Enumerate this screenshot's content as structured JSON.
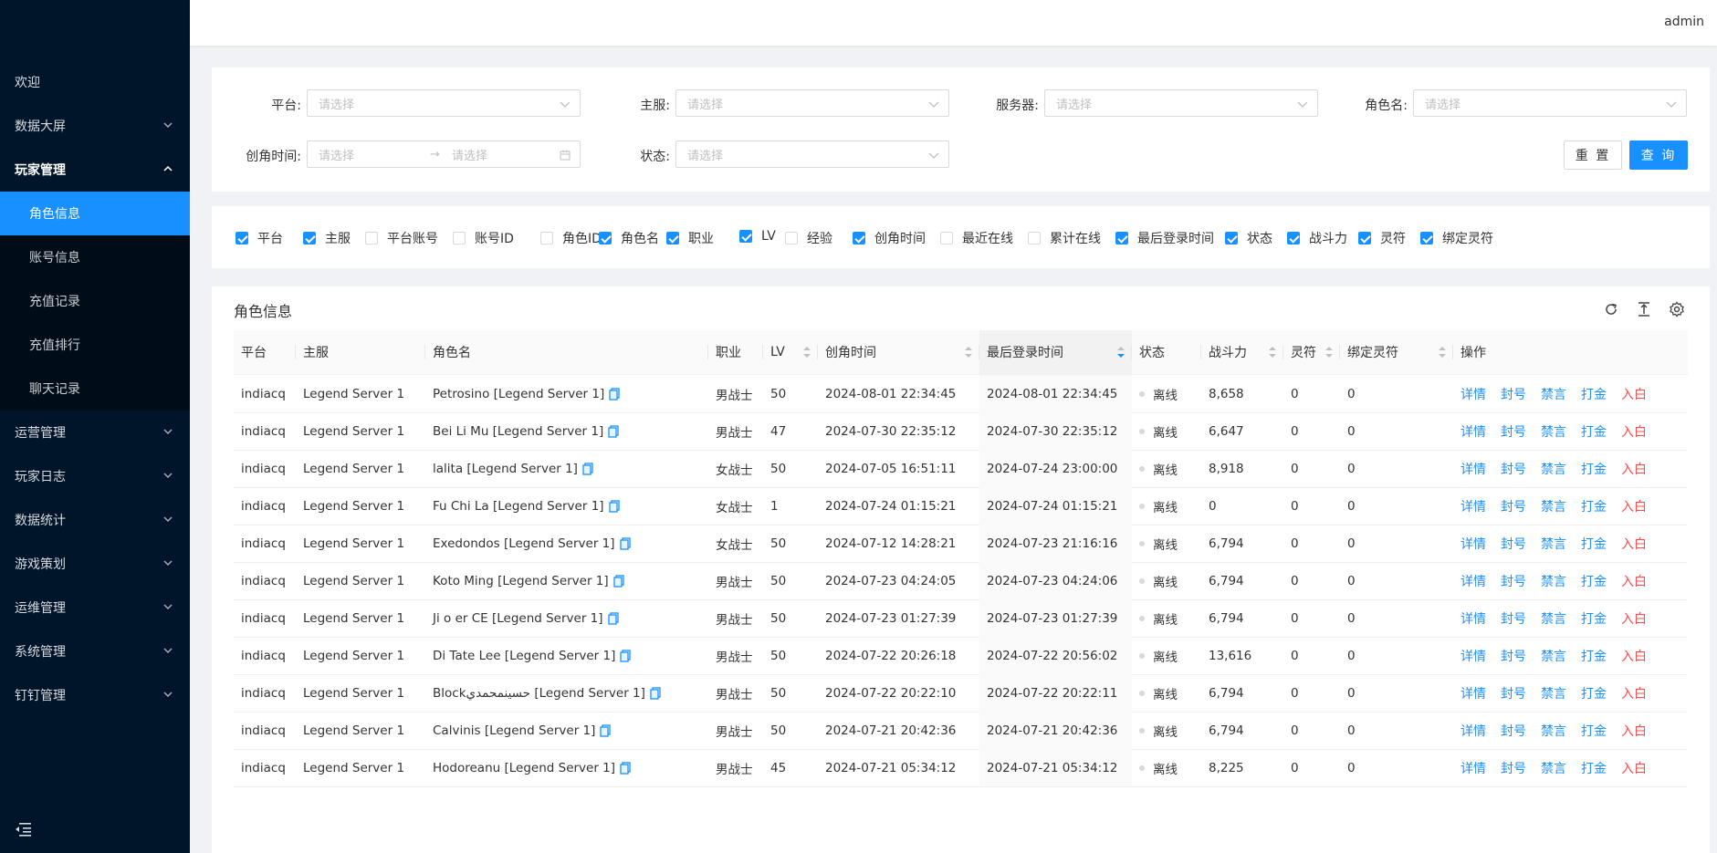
{
  "header": {
    "user": "admin"
  },
  "sidebar": {
    "items": [
      {
        "label": "欢迎",
        "type": "top",
        "chev": false
      },
      {
        "label": "数据大屏",
        "type": "top",
        "chev": "down"
      },
      {
        "label": "玩家管理",
        "type": "open",
        "chev": "up"
      },
      {
        "label": "角色信息",
        "type": "active"
      },
      {
        "label": "账号信息",
        "type": "sub"
      },
      {
        "label": "充值记录",
        "type": "sub"
      },
      {
        "label": "充值排行",
        "type": "sub"
      },
      {
        "label": "聊天记录",
        "type": "sub"
      },
      {
        "label": "运营管理",
        "type": "top",
        "chev": "down"
      },
      {
        "label": "玩家日志",
        "type": "top",
        "chev": "down"
      },
      {
        "label": "数据统计",
        "type": "top",
        "chev": "down"
      },
      {
        "label": "游戏策划",
        "type": "top",
        "chev": "down"
      },
      {
        "label": "运维管理",
        "type": "top",
        "chev": "down"
      },
      {
        "label": "系统管理",
        "type": "top",
        "chev": "down"
      },
      {
        "label": "钉钉管理",
        "type": "top",
        "chev": "down"
      }
    ]
  },
  "filters": {
    "platform": {
      "label": "平台:",
      "placeholder": "请选择"
    },
    "main_server": {
      "label": "主服:",
      "placeholder": "请选择"
    },
    "server": {
      "label": "服务器:",
      "placeholder": "请选择"
    },
    "role_name": {
      "label": "角色名:",
      "placeholder": "请选择"
    },
    "created": {
      "label": "创角时间:",
      "start": "请选择",
      "end": "请选择"
    },
    "status": {
      "label": "状态:",
      "placeholder": "请选择"
    },
    "reset": "重 置",
    "query": "查 询"
  },
  "columns": [
    {
      "label": "平台",
      "checked": true
    },
    {
      "label": "主服",
      "checked": true
    },
    {
      "label": "平台账号",
      "checked": false
    },
    {
      "label": "账号ID",
      "checked": false
    },
    {
      "label": "角色ID",
      "checked": false
    },
    {
      "label": "角色名",
      "checked": true
    },
    {
      "label": "职业",
      "checked": true
    },
    {
      "label": "LV",
      "checked": true
    },
    {
      "label": "经验",
      "checked": false
    },
    {
      "label": "创角时间",
      "checked": true
    },
    {
      "label": "最近在线",
      "checked": false
    },
    {
      "label": "累计在线",
      "checked": false
    },
    {
      "label": "最后登录时间",
      "checked": true
    },
    {
      "label": "状态",
      "checked": true
    },
    {
      "label": "战斗力",
      "checked": true
    },
    {
      "label": "灵符",
      "checked": true
    },
    {
      "label": "绑定灵符",
      "checked": true
    }
  ],
  "table": {
    "title": "角色信息",
    "headers": [
      "平台",
      "主服",
      "角色名",
      "职业",
      "LV",
      "创角时间",
      "最后登录时间",
      "状态",
      "战斗力",
      "灵符",
      "绑定灵符",
      "操作"
    ],
    "actions": [
      "详情",
      "封号",
      "禁言",
      "打金",
      "入白"
    ],
    "rows": [
      {
        "platform": "indiacq",
        "server": "Legend Server 1",
        "name": "Petrosino [Legend Server 1]",
        "class": "男战士",
        "lv": "50",
        "created": "2024-08-01 22:34:45",
        "last": "2024-08-01 22:34:45",
        "status": "离线",
        "power": "8,658",
        "fu": "0",
        "bfu": "0"
      },
      {
        "platform": "indiacq",
        "server": "Legend Server 1",
        "name": "Bei Li Mu [Legend Server 1]",
        "class": "男战士",
        "lv": "47",
        "created": "2024-07-30 22:35:12",
        "last": "2024-07-30 22:35:12",
        "status": "离线",
        "power": "6,647",
        "fu": "0",
        "bfu": "0"
      },
      {
        "platform": "indiacq",
        "server": "Legend Server 1",
        "name": "lalita [Legend Server 1]",
        "class": "女战士",
        "lv": "50",
        "created": "2024-07-05 16:51:11",
        "last": "2024-07-24 23:00:00",
        "status": "离线",
        "power": "8,918",
        "fu": "0",
        "bfu": "0"
      },
      {
        "platform": "indiacq",
        "server": "Legend Server 1",
        "name": "Fu Chi La [Legend Server 1]",
        "class": "女战士",
        "lv": "1",
        "created": "2024-07-24 01:15:21",
        "last": "2024-07-24 01:15:21",
        "status": "离线",
        "power": "0",
        "fu": "0",
        "bfu": "0"
      },
      {
        "platform": "indiacq",
        "server": "Legend Server 1",
        "name": "Exedondos [Legend Server 1]",
        "class": "女战士",
        "lv": "50",
        "created": "2024-07-12 14:28:21",
        "last": "2024-07-23 21:16:16",
        "status": "离线",
        "power": "6,794",
        "fu": "0",
        "bfu": "0"
      },
      {
        "platform": "indiacq",
        "server": "Legend Server 1",
        "name": "Koto Ming [Legend Server 1]",
        "class": "男战士",
        "lv": "50",
        "created": "2024-07-23 04:24:05",
        "last": "2024-07-23 04:24:06",
        "status": "离线",
        "power": "6,794",
        "fu": "0",
        "bfu": "0"
      },
      {
        "platform": "indiacq",
        "server": "Legend Server 1",
        "name": "Ji o er CE [Legend Server 1]",
        "class": "男战士",
        "lv": "50",
        "created": "2024-07-23 01:27:39",
        "last": "2024-07-23 01:27:39",
        "status": "离线",
        "power": "6,794",
        "fu": "0",
        "bfu": "0"
      },
      {
        "platform": "indiacq",
        "server": "Legend Server 1",
        "name": "Di Tate Lee [Legend Server 1]",
        "class": "男战士",
        "lv": "50",
        "created": "2024-07-22 20:26:18",
        "last": "2024-07-22 20:56:02",
        "status": "离线",
        "power": "13,616",
        "fu": "0",
        "bfu": "0"
      },
      {
        "platform": "indiacq",
        "server": "Legend Server 1",
        "name": "Blockحسينمحمدي [Legend Server 1]",
        "class": "男战士",
        "lv": "50",
        "created": "2024-07-22 20:22:10",
        "last": "2024-07-22 20:22:11",
        "status": "离线",
        "power": "6,794",
        "fu": "0",
        "bfu": "0"
      },
      {
        "platform": "indiacq",
        "server": "Legend Server 1",
        "name": "Calvinis [Legend Server 1]",
        "class": "男战士",
        "lv": "50",
        "created": "2024-07-21 20:42:36",
        "last": "2024-07-21 20:42:36",
        "status": "离线",
        "power": "6,794",
        "fu": "0",
        "bfu": "0"
      },
      {
        "platform": "indiacq",
        "server": "Legend Server 1",
        "name": "Hodoreanu [Legend Server 1]",
        "class": "男战士",
        "lv": "45",
        "created": "2024-07-21 05:34:12",
        "last": "2024-07-21 05:34:12",
        "status": "离线",
        "power": "8,225",
        "fu": "0",
        "bfu": "0"
      }
    ]
  }
}
